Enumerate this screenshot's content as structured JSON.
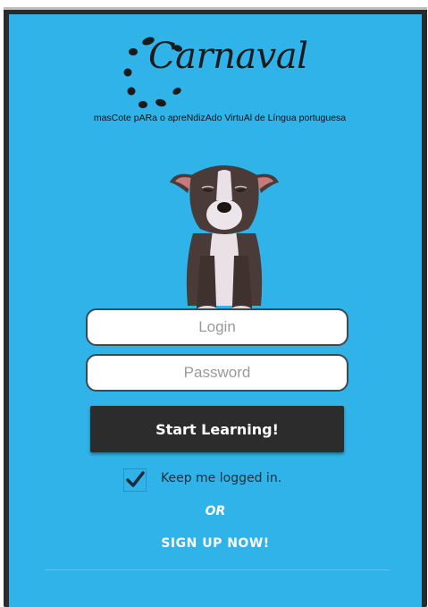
{
  "logo": {
    "text": "Carnaval"
  },
  "subtitle": "masCote pARa o apreNdizAdo VirtuAl de Língua portuguesa",
  "form": {
    "login_placeholder": "Login",
    "password_placeholder": "Password",
    "start_label": "Start Learning!",
    "keep_logged_label": "Keep me logged in.",
    "keep_logged_checked": true
  },
  "or_label": "OR",
  "signup_label": "SIGN UP NOW!",
  "colors": {
    "background": "#2fb3e9",
    "button": "#2c2c2c",
    "text_light": "#ffffff"
  }
}
